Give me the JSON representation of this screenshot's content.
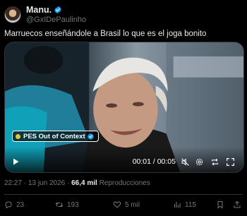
{
  "author": {
    "display_name": "Manu.",
    "handle": "@GxIDePaulinho"
  },
  "tweet": {
    "text": "Marruecos enseñándole a Brasil lo que es el joga bonito"
  },
  "video": {
    "watermark": "PES Out of Context",
    "time": "00:01 / 00:05"
  },
  "meta": {
    "time": "22:27",
    "date": "13 jun 2026",
    "views_count": "66,4 mil",
    "views_label": "Reproducciones",
    "sep1": " · ",
    "sep2": " · "
  },
  "actions": {
    "replies": "23",
    "retweets": "193",
    "likes": "5 mil",
    "views": "115"
  },
  "colors": {
    "background": "#000000",
    "text": "#e7e9ea",
    "muted": "#71767b",
    "verified": "#1d9bf0"
  }
}
